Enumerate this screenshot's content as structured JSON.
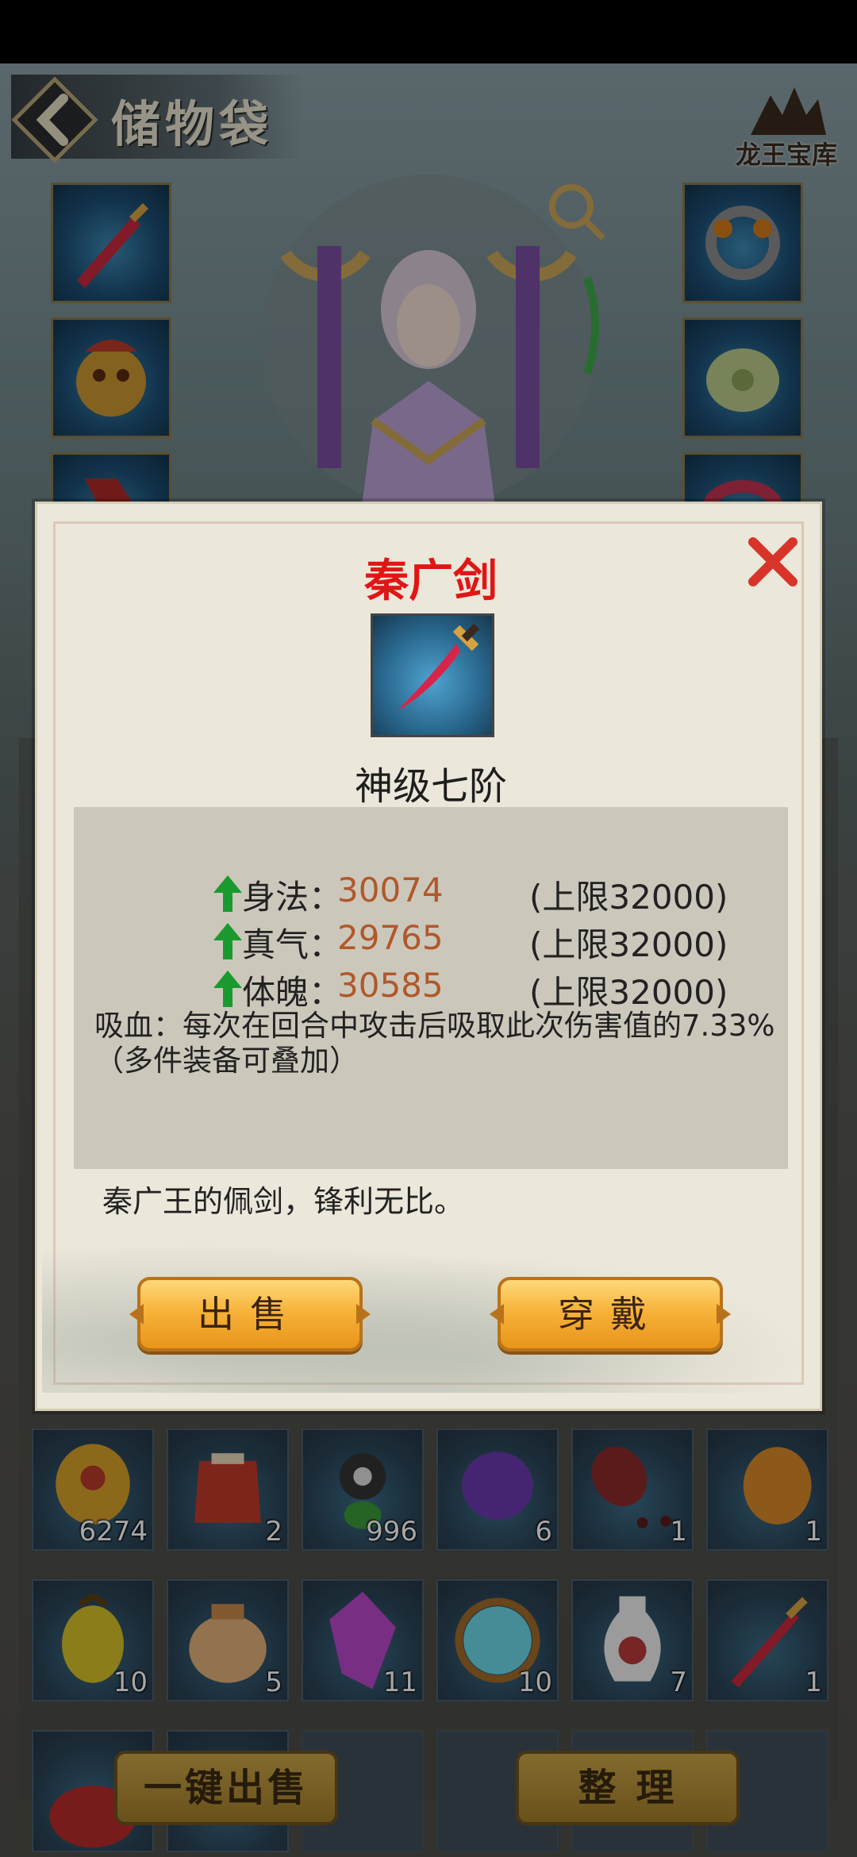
{
  "header": {
    "title": "储物袋",
    "logo_text": "龙王宝库"
  },
  "equipment": {
    "left": [
      "sword-icon",
      "demon-helmet-icon",
      "boots-icon"
    ],
    "right": [
      "ring-icon",
      "jade-pendant-icon",
      "bracelet-icon"
    ]
  },
  "inventory": {
    "row1": [
      {
        "icon": "golden-egg-icon",
        "count": "6274"
      },
      {
        "icon": "red-pouch-icon",
        "count": "2"
      },
      {
        "icon": "yin-yang-gourd-icon",
        "count": "996"
      },
      {
        "icon": "purple-fruit-icon",
        "count": "6"
      },
      {
        "icon": "red-vase-icon",
        "count": "1"
      },
      {
        "icon": "orange-gourd-icon",
        "count": "1"
      }
    ],
    "row2": [
      {
        "icon": "yellow-fruit-icon",
        "count": "10"
      },
      {
        "icon": "treasure-bag-icon",
        "count": "5"
      },
      {
        "icon": "purple-crystal-icon",
        "count": "11"
      },
      {
        "icon": "dragon-orb-icon",
        "count": "10"
      },
      {
        "icon": "porcelain-vase-icon",
        "count": "7"
      },
      {
        "icon": "sword-icon",
        "count": "1"
      }
    ],
    "row3": [
      {
        "icon": "red-meat-icon",
        "count": ""
      },
      {
        "icon": "gold-flower-icon",
        "count": ""
      }
    ]
  },
  "bottom_buttons": {
    "sell_all": "一键出售",
    "sort": "整 理"
  },
  "dialog": {
    "item_name": "秦广剑",
    "grade": "神级七阶",
    "stats": [
      {
        "name": "身法：",
        "value": "30074",
        "cap": "(上限32000)"
      },
      {
        "name": "真气：",
        "value": "29765",
        "cap": "(上限32000)"
      },
      {
        "name": "体魄：",
        "value": "30585",
        "cap": "(上限32000)"
      }
    ],
    "effect_line1": "吸血：每次在回合中攻击后吸取此次伤害值的7.33%",
    "effect_line2": "（多件装备可叠加）",
    "description": "秦广王的佩剑，锋利无比。",
    "sell_label": "出售",
    "equip_label": "穿戴"
  },
  "colors": {
    "item_name": "#e01616",
    "stat_value": "#b0582a",
    "arrow": "#1a9a2e",
    "button_gold": "#f7b33a"
  }
}
